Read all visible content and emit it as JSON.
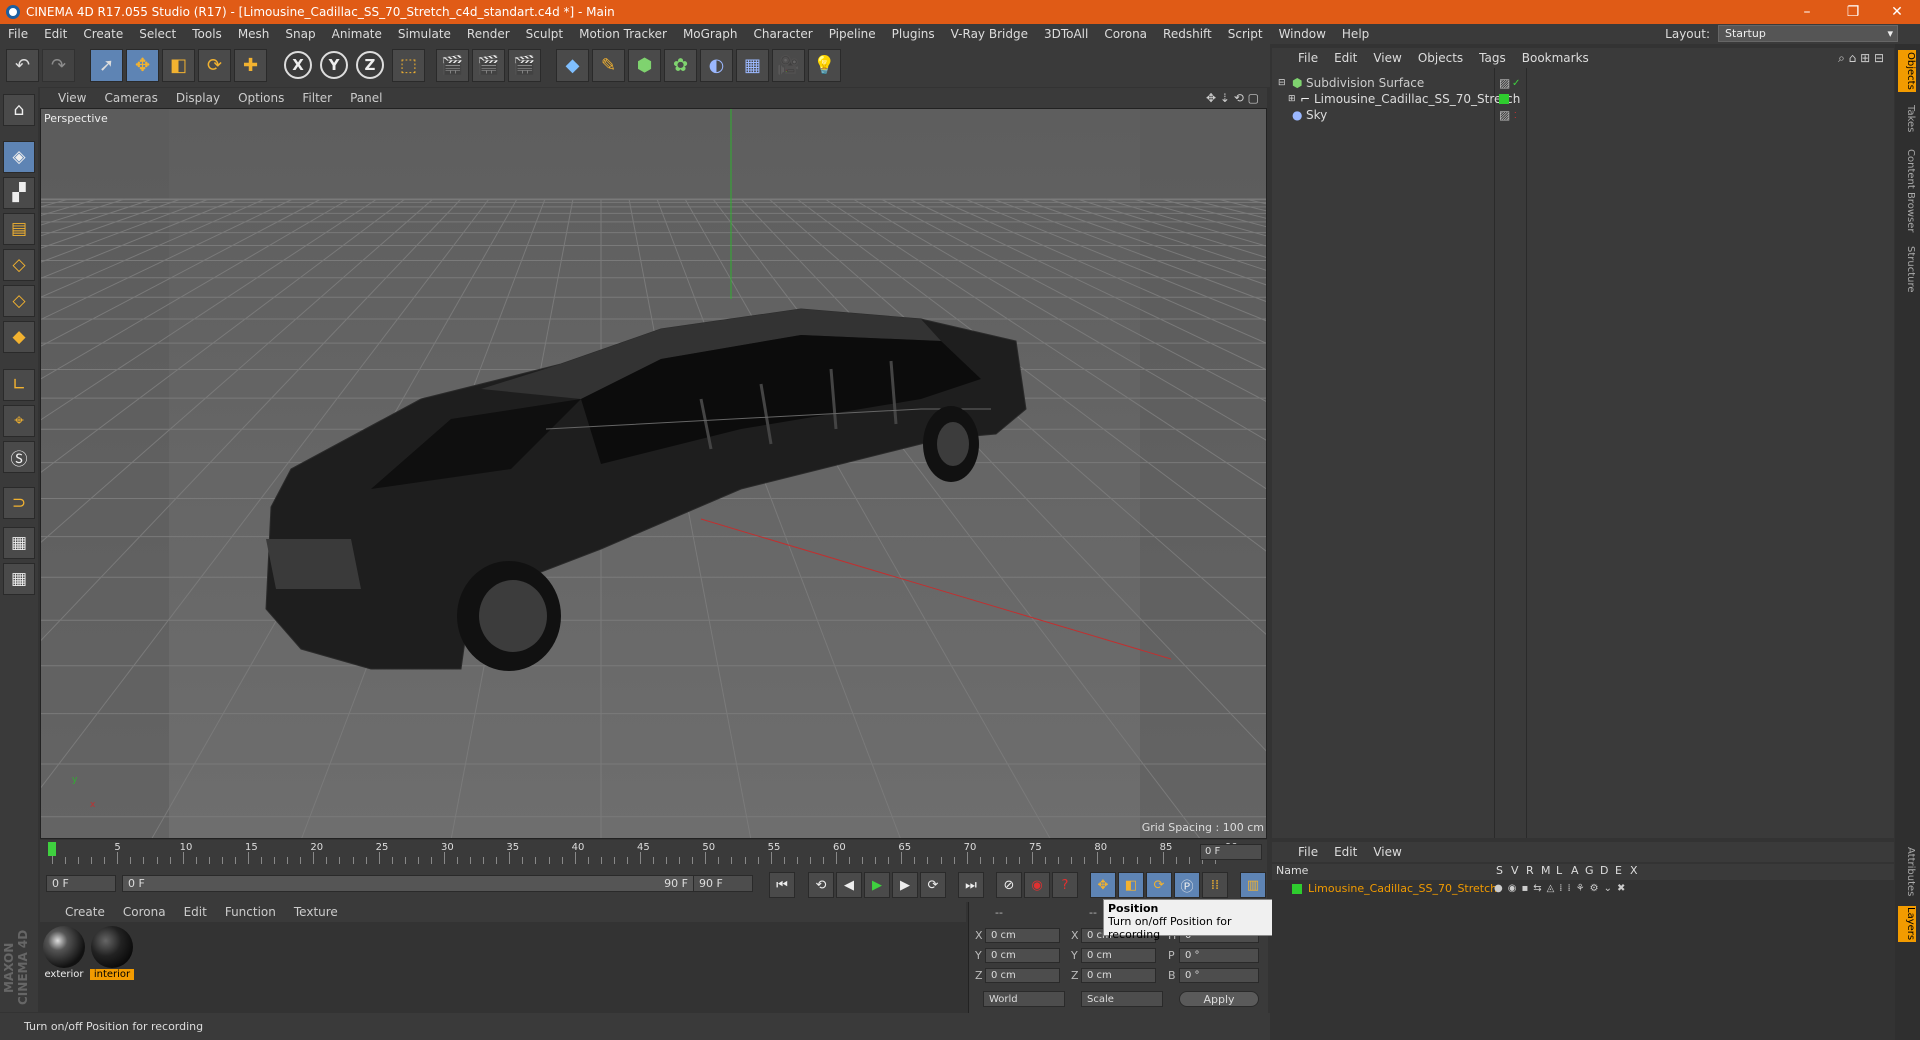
{
  "window": {
    "title": "CINEMA 4D R17.055 Studio (R17) - [Limousine_Cadillac_SS_70_Stretch_c4d_standart.c4d *] - Main",
    "controls": [
      "–",
      "❐",
      "✕"
    ]
  },
  "menubar": {
    "items": [
      "File",
      "Edit",
      "Create",
      "Select",
      "Tools",
      "Mesh",
      "Snap",
      "Animate",
      "Simulate",
      "Render",
      "Sculpt",
      "Motion Tracker",
      "MoGraph",
      "Character",
      "Pipeline",
      "Plugins",
      "V-Ray Bridge",
      "3DToAll",
      "Corona",
      "Redshift",
      "Script",
      "Window",
      "Help"
    ],
    "layout_label": "Layout:",
    "layout_value": "Startup"
  },
  "toolbar": {
    "axis_x": "X",
    "axis_y": "Y",
    "axis_z": "Z"
  },
  "viewport": {
    "menu": [
      "View",
      "Cameras",
      "Display",
      "Options",
      "Filter",
      "Panel"
    ],
    "name": "Perspective",
    "grid_spacing": "Grid Spacing : 100 cm",
    "axis_y": "y",
    "axis_x": "x"
  },
  "timeline": {
    "ticks": [
      "0",
      "5",
      "10",
      "15",
      "20",
      "25",
      "30",
      "35",
      "40",
      "45",
      "50",
      "55",
      "60",
      "65",
      "70",
      "75",
      "80",
      "85",
      "90"
    ],
    "current_frame": "0 F",
    "start_frame": "0 F",
    "range_start": "0 F",
    "range_end": "90 F",
    "end_frame": "90 F"
  },
  "materials": {
    "menu": [
      "Create",
      "Corona",
      "Edit",
      "Function",
      "Texture"
    ],
    "items": [
      {
        "name": "exterior",
        "selected": false
      },
      {
        "name": "interior",
        "selected": true
      }
    ]
  },
  "coordinates": {
    "header1": "--",
    "header2": "--",
    "rows": [
      {
        "a": "X",
        "av": "0 cm",
        "b": "X",
        "bv": "0 cm",
        "c": "H",
        "cv": "0 °"
      },
      {
        "a": "Y",
        "av": "0 cm",
        "b": "Y",
        "bv": "0 cm",
        "c": "P",
        "cv": "0 °"
      },
      {
        "a": "Z",
        "av": "0 cm",
        "b": "Z",
        "bv": "0 cm",
        "c": "B",
        "cv": "0 °"
      }
    ],
    "space": "World",
    "mode": "Scale",
    "apply": "Apply"
  },
  "tooltip": {
    "title": "Position",
    "text": "Turn on/off Position for recording"
  },
  "statusbar": {
    "text": "Turn on/off Position for recording",
    "maxon": "MAXON CINEMA 4D"
  },
  "object_manager": {
    "menu": [
      "File",
      "Edit",
      "View",
      "Objects",
      "Tags",
      "Bookmarks"
    ],
    "objects": [
      {
        "name": "Subdivision Surface",
        "color": "#7fd36f"
      },
      {
        "name": "Limousine_Cadillac_SS_70_Stretch",
        "color": "#dddddd"
      },
      {
        "name": "Sky",
        "color": "#dddddd"
      }
    ]
  },
  "layer_manager": {
    "menu": [
      "File",
      "Edit",
      "View"
    ],
    "columns": [
      "Name",
      "S",
      "V",
      "R",
      "M",
      "L",
      "A",
      "G",
      "D",
      "E",
      "X"
    ],
    "layers": [
      {
        "name": "Limousine_Cadillac_SS_70_Stretch",
        "color": "#2ecc2e"
      }
    ]
  },
  "right_tabs": [
    "Objects",
    "Takes",
    "Content Browser",
    "Structure",
    "Attributes",
    "Layers"
  ],
  "colors": {
    "titlebar": "#e05b16",
    "selected": "#5e84b4",
    "highlight": "#f29b00"
  }
}
